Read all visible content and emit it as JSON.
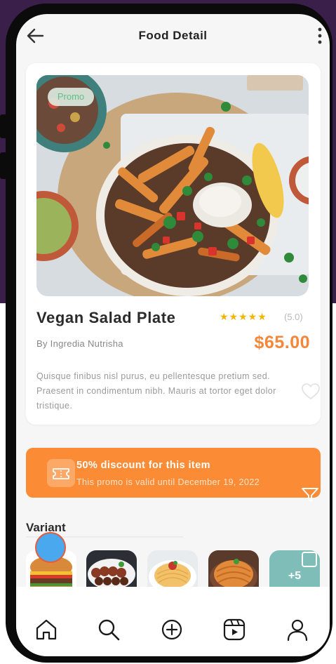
{
  "header": {
    "title": "Food Detail"
  },
  "food": {
    "promo_tag": "Promo",
    "name": "Vegan Salad Plate",
    "stars": "★★★★★",
    "rating": "(5.0)",
    "byline": "By Ingredia Nutrisha",
    "price": "$65.00",
    "description": "Quisque finibus nisl purus, eu pellentesque  pretium sed. Praesent in condimentum nibh. Mauris at tortor eget dolor tristique."
  },
  "promo": {
    "title": "50% discount for this item",
    "subtitle": "This promo is valid until December 19, 2022"
  },
  "variants": {
    "label": "Variant",
    "items": [
      "burger",
      "skewers",
      "spaghetti",
      "pasta"
    ],
    "more": "+5"
  },
  "tabbar": {
    "items": [
      "home-icon",
      "search-icon",
      "add-icon",
      "video-icon",
      "profile-icon"
    ]
  },
  "colors": {
    "accent": "#fb8b34",
    "price": "#f5863a",
    "star": "#f5b400",
    "promo_tag_text": "#5fbf8a",
    "background_top": "#3a1f4a"
  }
}
